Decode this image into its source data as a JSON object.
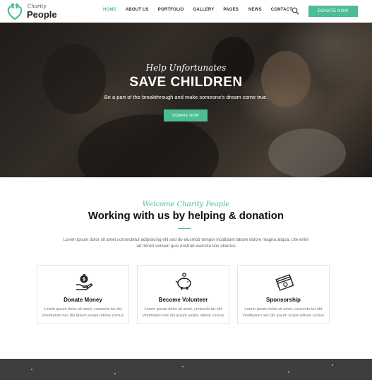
{
  "logo": {
    "small": "Charity",
    "big": "People"
  },
  "nav": {
    "items": [
      {
        "label": "HOME",
        "active": true
      },
      {
        "label": "ABOUT US",
        "active": false
      },
      {
        "label": "PORTFOLIO",
        "active": false
      },
      {
        "label": "GALLERY",
        "active": false
      },
      {
        "label": "PAGES",
        "active": false
      },
      {
        "label": "NEWS",
        "active": false
      },
      {
        "label": "CONTACT",
        "active": false
      }
    ],
    "search_icon": "search-icon",
    "donate_label": "DONATE NOW"
  },
  "hero": {
    "script": "Help Unfortunates",
    "title": "SAVE CHILDREN",
    "subtitle": "Be a part of the breakthrough and make someone's dream come true.",
    "button_label": "DONATE NOW"
  },
  "welcome": {
    "script": "Welcome Charity People",
    "title": "Working with us by helping & donation",
    "text": "Lorem ipsum dolor sit amet consectetur adipisicing elit sed do eiusmod tempor incididunt labore dolore magna aliqua. Ute enim ad minim veniam quis nostrud exercita tion ullamco"
  },
  "cards": [
    {
      "title": "Donate Money",
      "icon": "hand-money-icon",
      "text": "Lorem ipsum dolor sit amet, consecte tur elit. Vestibulum nec dio ipsum suspe ndisse cursus."
    },
    {
      "title": "Become Volunteer",
      "icon": "piggy-bank-icon",
      "text": "Lorem ipsum dolor sit amet, consecte tur elit. Vestibulum nec dio ipsum suspe ndisse cursus."
    },
    {
      "title": "Sponsorship",
      "icon": "money-stack-icon",
      "text": "Lorem ipsum dolor sit amet, consecte tur elit. Vestibulum nec dio ipsum suspe ndisse cursus."
    }
  ],
  "colors": {
    "accent": "#4dbd95",
    "dark_band": "#3e3d3f"
  }
}
